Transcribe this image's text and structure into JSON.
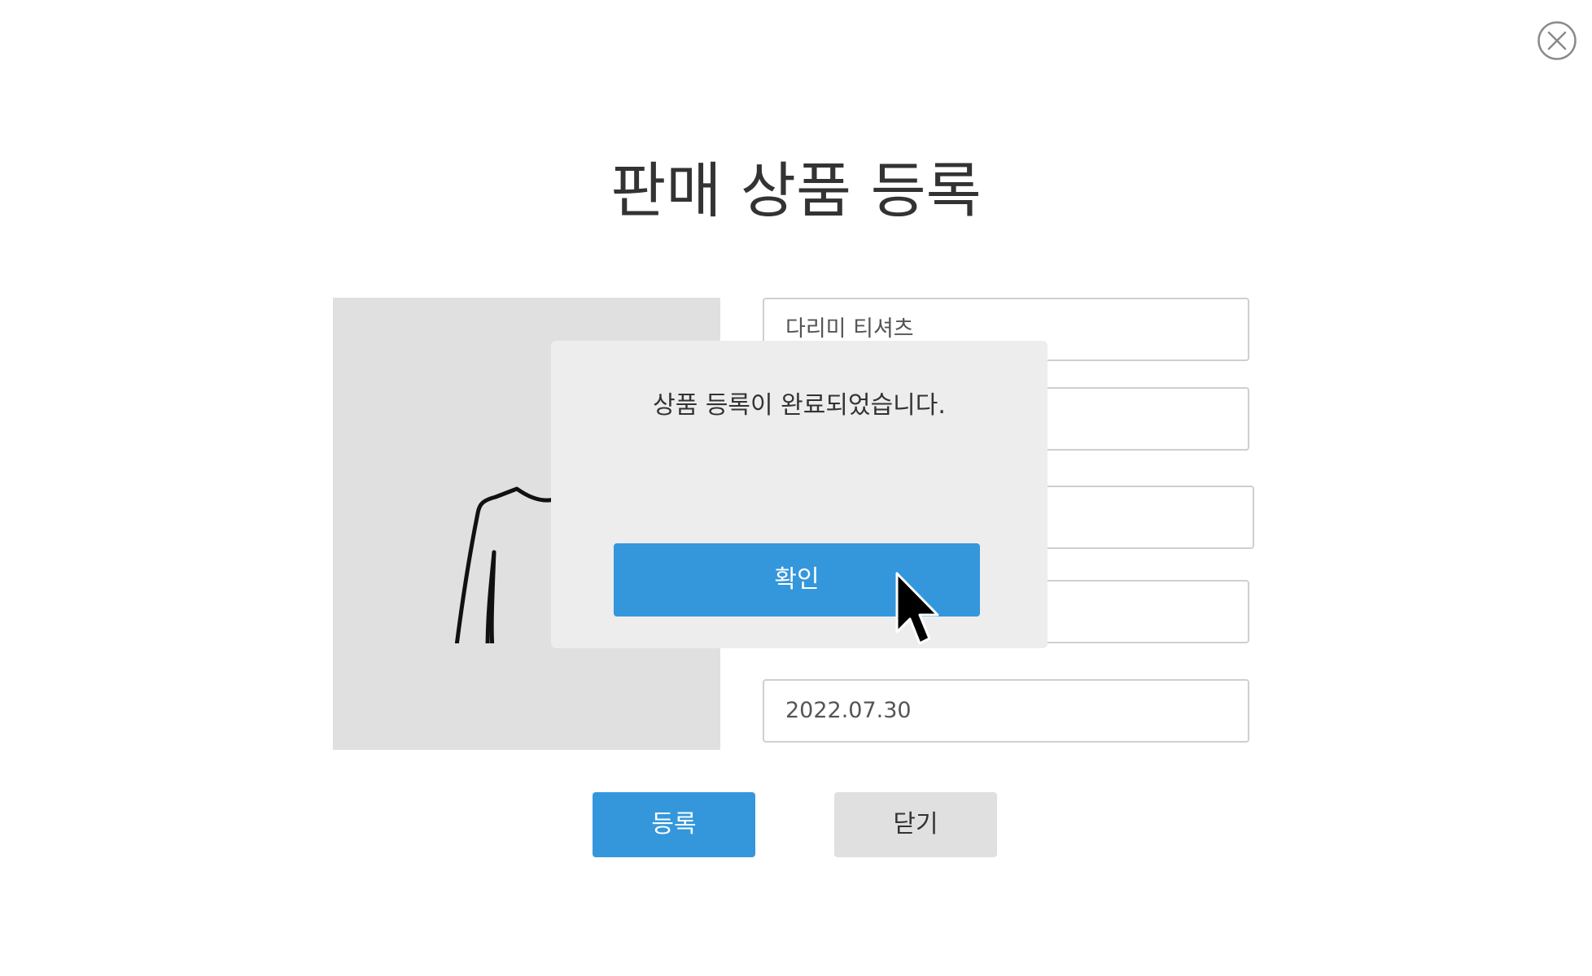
{
  "page": {
    "title": "판매 상품 등록"
  },
  "form": {
    "product_name": "다리미 티셔츠",
    "field2": "",
    "field3": "",
    "field4": "",
    "date": "2022.07.30"
  },
  "buttons": {
    "register": "등록",
    "close": "닫기"
  },
  "modal": {
    "message": "상품 등록이 완료되었습니다.",
    "confirm": "확인"
  },
  "icons": {
    "close": "close-icon",
    "product_image": "shirt-icon",
    "cursor": "mouse-cursor-icon"
  },
  "colors": {
    "accent": "#3497db",
    "panel": "#e0e0e0",
    "modal_bg": "#ededed"
  }
}
